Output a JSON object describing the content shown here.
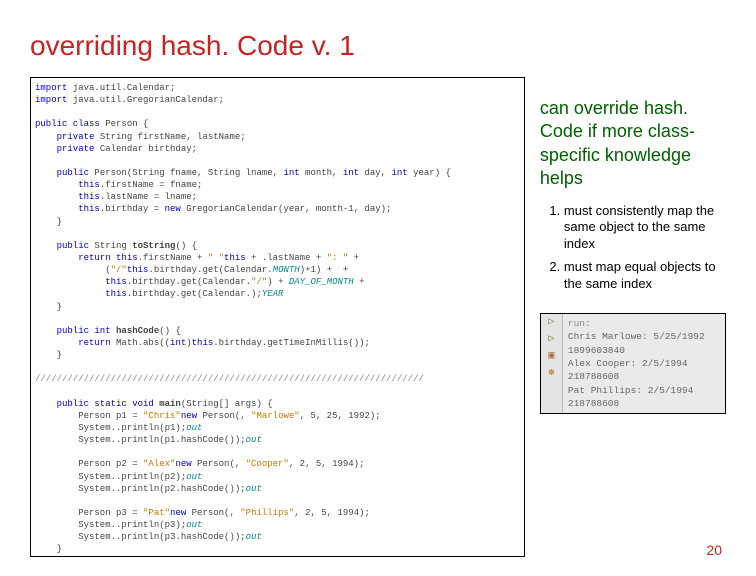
{
  "title": "overriding hash. Code v. 1",
  "explain": "can override hash. Code if more class-specific knowledge helps",
  "rules": [
    "must consistently map the same object to the same index",
    "must map equal objects to the same index"
  ],
  "code_lines": [
    {
      "t": "import",
      "c": "kw",
      "r": " java.util.Calendar;"
    },
    {
      "t": "import",
      "c": "kw",
      "r": " java.util.GregorianCalendar;"
    },
    {
      "t": "",
      "c": "",
      "r": ""
    },
    {
      "t": "public class",
      "c": "kw",
      "r": " Person {"
    },
    {
      "t": "    private",
      "c": "kw",
      "r": " String firstName, lastName;"
    },
    {
      "t": "    private",
      "c": "kw",
      "r": " Calendar birthday;"
    },
    {
      "t": "",
      "c": "",
      "r": ""
    },
    {
      "t": "    public",
      "c": "kw",
      "r": " Person(String fname, String lname, ",
      "t2": "int",
      "c2": "kw",
      "r2": " month, ",
      "t3": "int",
      "c3": "kw",
      "r3": " day, ",
      "t4": "int",
      "c4": "kw",
      "r4": " year) {"
    },
    {
      "t": "        this",
      "c": "kw",
      "r": ".firstName = fname;"
    },
    {
      "t": "        this",
      "c": "kw",
      "r": ".lastName = lname;"
    },
    {
      "t": "        this",
      "c": "kw",
      "r": ".birthday = ",
      "t2": "new",
      "c2": "kw",
      "r2": " GregorianCalendar(year, month-1, day);"
    },
    {
      "t": "",
      "c": "",
      "r": "    }"
    },
    {
      "t": "",
      "c": "",
      "r": ""
    },
    {
      "t": "    public",
      "c": "kw",
      "r": " String ",
      "b": "toString",
      "r2": "() {"
    },
    {
      "t": "        return this",
      "c": "kw",
      "r": ".firstName + ",
      "s": "\" \"",
      "r2": " + ",
      "t2": "this",
      "c2": "kw",
      "r3": ".lastName + ",
      "s2": "\": \"",
      "r4": " +"
    },
    {
      "t": "",
      "c": "",
      "r": "             (",
      "t2": "this",
      "c2": "kw",
      "r2": ".birthday.get(Calendar.",
      "i": "MONTH",
      "r3": ")+1) + ",
      "s": "\"/\"",
      "r4": " +"
    },
    {
      "t": "             this",
      "c": "kw",
      "r": ".birthday.get(Calendar.",
      "i": "DAY_OF_MONTH",
      "r2": ") + ",
      "s": "\"/\"",
      "r3": " +"
    },
    {
      "t": "             this",
      "c": "kw",
      "r": ".birthday.get(Calendar.",
      "i": "YEAR",
      "r2": ");"
    },
    {
      "t": "",
      "c": "",
      "r": "    }"
    },
    {
      "t": "",
      "c": "",
      "r": ""
    },
    {
      "t": "    public int",
      "c": "kw",
      "r": " ",
      "b": "hashCode",
      "r2": "() {"
    },
    {
      "t": "        return",
      "c": "kw",
      "r": " Math.abs((",
      "t2": "int",
      "c2": "kw",
      "r2": ")",
      "t3": "this",
      "c3": "kw",
      "r3": ".birthday.getTimeInMillis());"
    },
    {
      "t": "",
      "c": "",
      "r": "    }"
    },
    {
      "t": "",
      "c": "",
      "r": ""
    },
    {
      "t": "////////////////////////////////////////////////////////////////////////",
      "c": "gray",
      "r": ""
    },
    {
      "t": "",
      "c": "",
      "r": ""
    },
    {
      "t": "    public static void",
      "c": "kw",
      "r": " ",
      "b": "main",
      "r2": "(String[] args) {"
    },
    {
      "t": "",
      "c": "",
      "r": "        Person p1 = ",
      "t2": "new",
      "c2": "kw",
      "r2": " Person(",
      "s": "\"Chris\"",
      "r3": ", ",
      "s2": "\"Marlowe\"",
      "r4": ", 5, 25, 1992);"
    },
    {
      "t": "",
      "c": "",
      "r": "        System.",
      "i": "out",
      "r2": ".println(p1);"
    },
    {
      "t": "",
      "c": "",
      "r": "        System.",
      "i": "out",
      "r2": ".println(p1.hashCode());"
    },
    {
      "t": "",
      "c": "",
      "r": ""
    },
    {
      "t": "",
      "c": "",
      "r": "        Person p2 = ",
      "t2": "new",
      "c2": "kw",
      "r2": " Person(",
      "s": "\"Alex\"",
      "r3": ", ",
      "s2": "\"Cooper\"",
      "r4": ", 2, 5, 1994);"
    },
    {
      "t": "",
      "c": "",
      "r": "        System.",
      "i": "out",
      "r2": ".println(p2);"
    },
    {
      "t": "",
      "c": "",
      "r": "        System.",
      "i": "out",
      "r2": ".println(p2.hashCode());"
    },
    {
      "t": "",
      "c": "",
      "r": ""
    },
    {
      "t": "",
      "c": "",
      "r": "        Person p3 = ",
      "t2": "new",
      "c2": "kw",
      "r2": " Person(",
      "s": "\"Pat\"",
      "r3": ", ",
      "s2": "\"Phillips\"",
      "r4": ", 2, 5, 1994);"
    },
    {
      "t": "",
      "c": "",
      "r": "        System.",
      "i": "out",
      "r2": ".println(p3);"
    },
    {
      "t": "",
      "c": "",
      "r": "        System.",
      "i": "out",
      "r2": ".println(p3.hashCode());"
    },
    {
      "t": "",
      "c": "",
      "r": "    }"
    },
    {
      "t": "",
      "c": "",
      "r": "}"
    }
  ],
  "output": {
    "run": "run:",
    "lines": [
      "Chris Marlowe: 5/25/1992",
      "1899603840",
      "Alex Cooper: 2/5/1994",
      "218788608",
      "Pat Phillips: 2/5/1994",
      "218788608"
    ]
  },
  "page": "20"
}
